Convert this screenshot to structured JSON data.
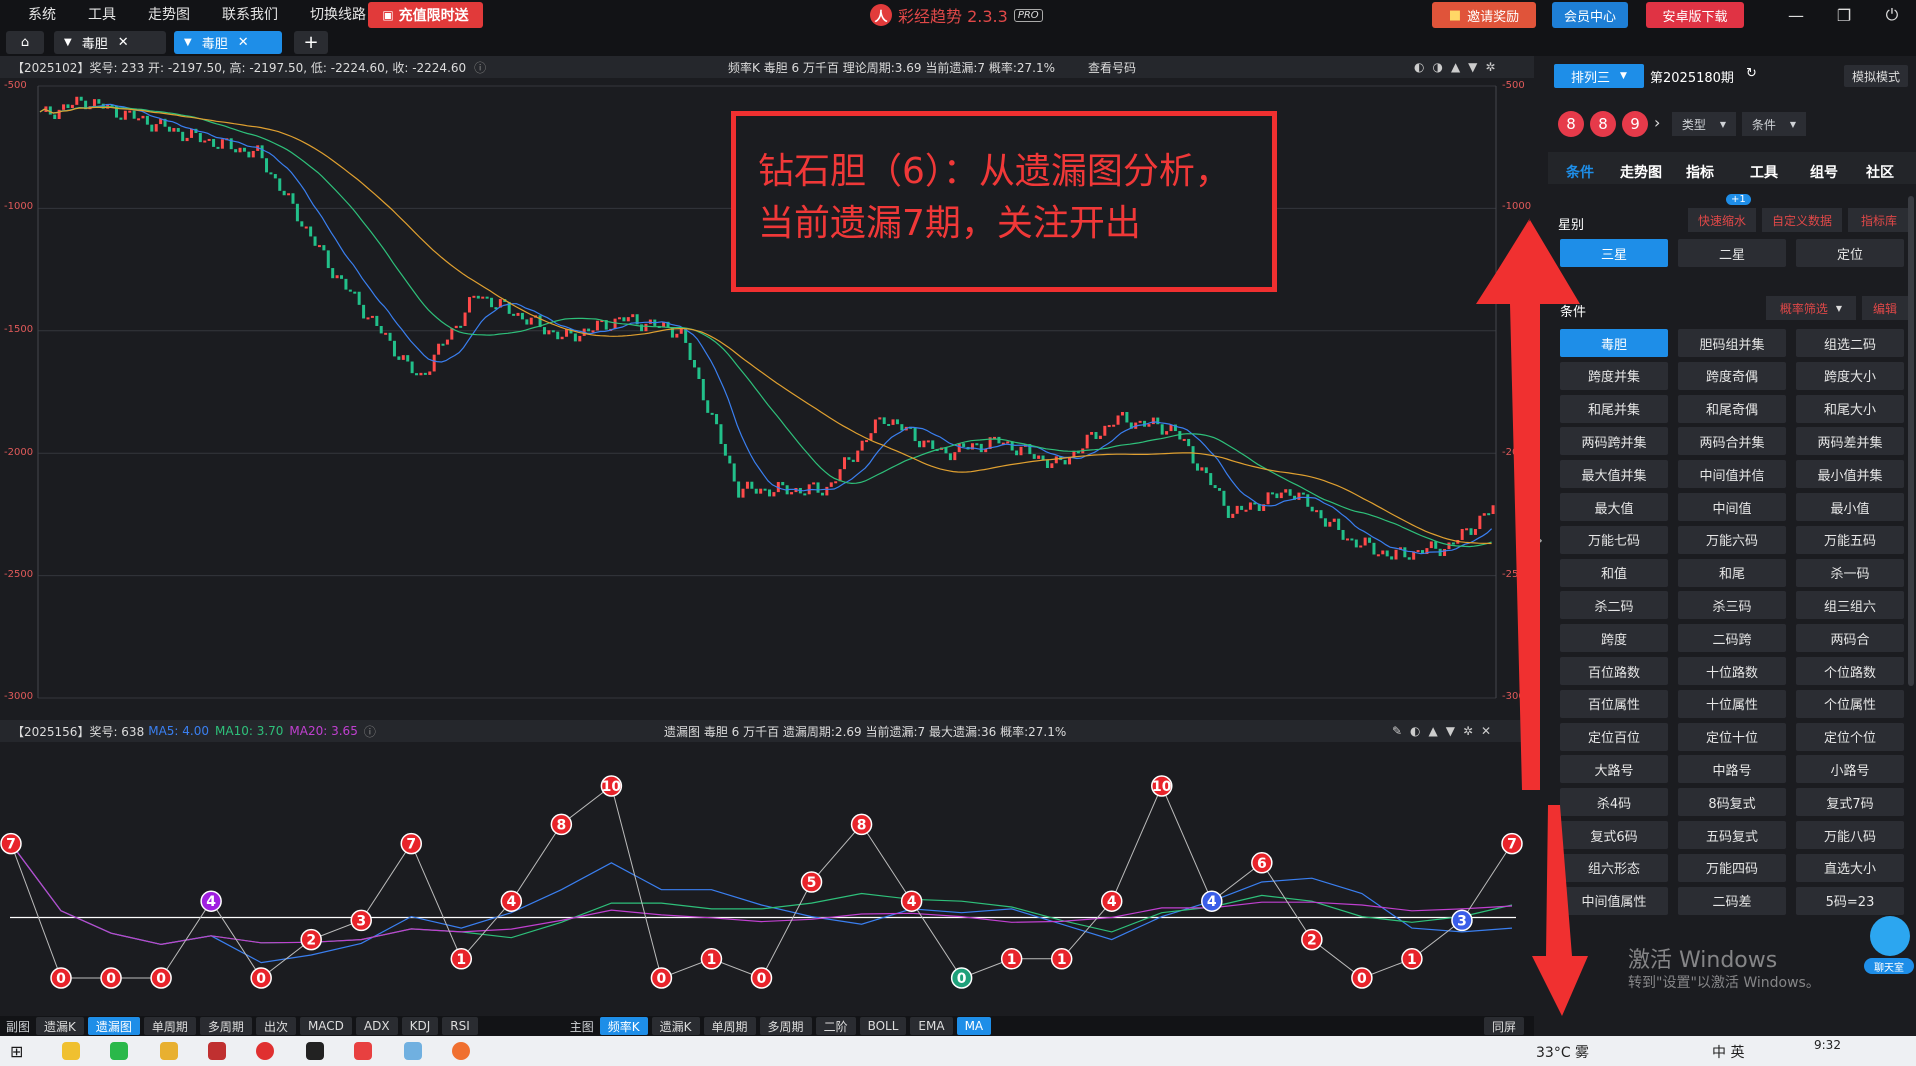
{
  "menu": [
    "系统",
    "工具",
    "走势图",
    "联系我们",
    "切换线路"
  ],
  "promo_label": "充值限时送",
  "app": {
    "title": "彩经趋势 2.3.3",
    "badge": "PRO"
  },
  "top_buttons": {
    "invite": "邀请奖励",
    "member": "会员中心",
    "android": "安卓版下载"
  },
  "tabs": [
    {
      "label": "毒胆"
    },
    {
      "label": "毒胆"
    }
  ],
  "upper_info": {
    "left": "【2025102】奖号: 233  开: -2197.50, 高: -2197.50, 低: -2224.60, 收: -2224.60",
    "mid": "频率K  毒胆  6  万千百  理论周期:3.69  当前遗漏:7  概率:27.1%",
    "link": "查看号码"
  },
  "upper_axis": [
    "-500",
    "-1000",
    "-1500",
    "-2000",
    "-2500",
    "-3000"
  ],
  "lower_info": {
    "left": "【2025156】奖号: 638",
    "ma5": "MA5: 4.00",
    "ma10": "MA10: 3.70",
    "ma20": "MA20: 3.65",
    "mid": "遗漏图  毒胆  6  万千百  遗漏周期:2.69  当前遗漏:7  最大遗漏:36  概率:27.1%"
  },
  "annotation": "钻石胆（6）：从遗漏图分析，\n当前遗漏7期，关注开出",
  "chart_data": {
    "type": "line",
    "title": "",
    "series": [
      {
        "name": "遗漏",
        "values": [
          7,
          0,
          0,
          0,
          4,
          0,
          2,
          3,
          7,
          1,
          4,
          8,
          10,
          0,
          1,
          0,
          5,
          8,
          4,
          0,
          1,
          1,
          4,
          10,
          4,
          6,
          2,
          0,
          1,
          3,
          7
        ]
      }
    ],
    "ylim": [
      0,
      10
    ],
    "highlight": {
      "4": "#a020e0",
      "24": "#3a5ee8",
      "19": "#1fa07a",
      "29": "#3a5ee8"
    }
  },
  "candles": {
    "close_start": -620,
    "close_end": -2224.6,
    "ylim": [
      -3000,
      -500
    ]
  },
  "bottom_left": {
    "label": "副图",
    "items": [
      "遗漏K",
      "遗漏图",
      "单周期",
      "多周期",
      "出次",
      "MACD",
      "ADX",
      "KDJ",
      "RSI"
    ]
  },
  "bottom_mid": {
    "label": "主图",
    "items": [
      "频率K",
      "遗漏K",
      "单周期",
      "多周期",
      "二阶",
      "BOLL",
      "EMA",
      "MA"
    ]
  },
  "bottom_right": "同屏",
  "right": {
    "lottery": "排列三",
    "period": "第2025180期",
    "mode": "模拟模式",
    "balls": [
      "8",
      "8",
      "9"
    ],
    "type_sel": "类型",
    "cond_sel": "条件",
    "tabs": [
      "条件",
      "走势图",
      "指标",
      "工具",
      "组号",
      "社区"
    ],
    "star_label": "星别",
    "quick": "快速缩水",
    "quick_badge": "+1",
    "custom": "自定义数据",
    "index_lib": "指标库",
    "stars": [
      "三星",
      "二星",
      "定位"
    ],
    "cond_label": "条件",
    "prob_filter": "概率筛选",
    "edit": "编辑",
    "grid": [
      "毒胆",
      "胆码组并集",
      "组选二码",
      "跨度并集",
      "跨度奇偶",
      "跨度大小",
      "和尾并集",
      "和尾奇偶",
      "和尾大小",
      "两码跨并集",
      "两码合并集",
      "两码差并集",
      "最大值并集",
      "中间值并信",
      "最小值并集",
      "最大值",
      "中间值",
      "最小值",
      "万能七码",
      "万能六码",
      "万能五码",
      "和值",
      "和尾",
      "杀一码",
      "杀二码",
      "杀三码",
      "组三组六",
      "跨度",
      "二码跨",
      "两码合",
      "百位路数",
      "十位路数",
      "个位路数",
      "百位属性",
      "十位属性",
      "个位属性",
      "定位百位",
      "定位十位",
      "定位个位",
      "大路号",
      "中路号",
      "小路号",
      "杀4码",
      "8码复式",
      "复式7码",
      "复式6码",
      "五码复式",
      "万能八码",
      "组六形态",
      "万能四码",
      "直选大小",
      "中间值属性",
      "二码差",
      "5码=23"
    ],
    "watermark1": "激活 Windows",
    "watermark2": "转到\"设置\"以激活 Windows。",
    "chat": "聊天室"
  },
  "taskbar": {
    "weather": "33°C 雾",
    "ime": "中 英",
    "time": "9:32"
  }
}
